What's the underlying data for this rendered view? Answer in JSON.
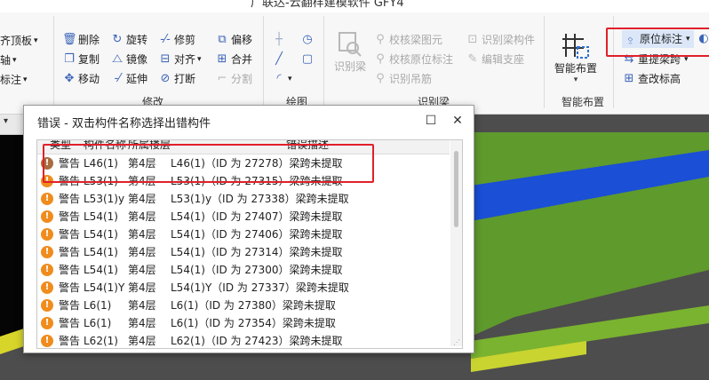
{
  "window": {
    "title": "广联达-云翻样建模软件 GFY4"
  },
  "ribbon": {
    "left_partial": [
      "齐顶板",
      "轴",
      "标注"
    ],
    "edit_group": {
      "label": "修改",
      "items": [
        "删除",
        "旋转",
        "修剪",
        "偏移",
        "复制",
        "镜像",
        "对齐",
        "合并",
        "移动",
        "延伸",
        "打断",
        "分割"
      ]
    },
    "draw_group": {
      "label": "绘图"
    },
    "beam_group": {
      "label": "识别梁",
      "big_label": "识别梁",
      "items": [
        "校核梁图元",
        "识别梁构件",
        "校核原位标注",
        "编辑支座",
        "识别吊筋"
      ]
    },
    "smart_group": {
      "label": "智能布置",
      "big_label": "智能布置"
    },
    "annot_group": {
      "items": [
        "原位标注",
        "重提梁跨",
        "查改标高"
      ]
    }
  },
  "dialog": {
    "title": "错误 - 双击构件名称选择出错构件",
    "columns": [
      "类型",
      "构件名称",
      "所属楼层",
      "错误描述"
    ],
    "rows": [
      {
        "type": "警告",
        "name": "L46(1)",
        "floor": "第4层",
        "desc": "L46(1)（ID 为 27278）梁跨未提取"
      },
      {
        "type": "警告",
        "name": "L53(1)",
        "floor": "第4层",
        "desc": "L53(1)（ID 为 27315）梁跨未提取"
      },
      {
        "type": "警告",
        "name": "L53(1)y",
        "floor": "第4层",
        "desc": "L53(1)y（ID 为 27338）梁跨未提取"
      },
      {
        "type": "警告",
        "name": "L54(1)",
        "floor": "第4层",
        "desc": "L54(1)（ID 为 27407）梁跨未提取"
      },
      {
        "type": "警告",
        "name": "L54(1)",
        "floor": "第4层",
        "desc": "L54(1)（ID 为 27406）梁跨未提取"
      },
      {
        "type": "警告",
        "name": "L54(1)",
        "floor": "第4层",
        "desc": "L54(1)（ID 为 27314）梁跨未提取"
      },
      {
        "type": "警告",
        "name": "L54(1)",
        "floor": "第4层",
        "desc": "L54(1)（ID 为 27300）梁跨未提取"
      },
      {
        "type": "警告",
        "name": "L54(1)Y",
        "floor": "第4层",
        "desc": "L54(1)Y（ID 为 27337）梁跨未提取"
      },
      {
        "type": "警告",
        "name": "L6(1)",
        "floor": "第4层",
        "desc": "L6(1)（ID 为 27380）梁跨未提取"
      },
      {
        "type": "警告",
        "name": "L6(1)",
        "floor": "第4层",
        "desc": "L6(1)（ID 为 27354）梁跨未提取"
      },
      {
        "type": "警告",
        "name": "L62(1)",
        "floor": "第4层",
        "desc": "L62(1)（ID 为 27423）梁跨未提取"
      }
    ]
  },
  "colors": {
    "highlight": "#e0202a",
    "warning": "#f08c1e",
    "beam_blue": "#1a4fd6",
    "slab_green": "#5f9a2c"
  }
}
